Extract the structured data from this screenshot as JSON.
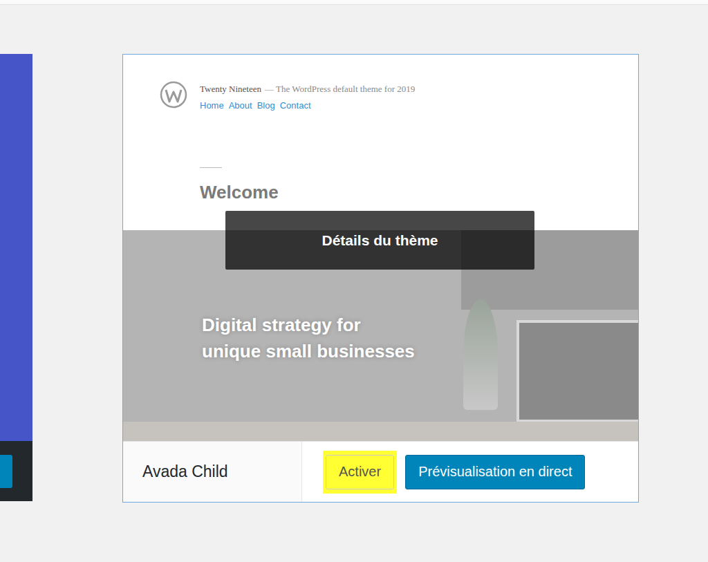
{
  "theme_card": {
    "screenshot": {
      "site_title": "Twenty Nineteen",
      "tagline": "— The WordPress default theme for 2019",
      "nav": [
        "Home",
        "About",
        "Blog",
        "Contact"
      ],
      "heading": "Welcome",
      "hero_lines": [
        "Digital strategy for",
        "unique small businesses"
      ]
    },
    "overlay": "Détails du thème",
    "name": "Avada Child",
    "buttons": [
      {
        "label": "Activer",
        "primary": false,
        "highlighted": true
      },
      {
        "label": "Prévisualisation en direct",
        "primary": true,
        "highlighted": false
      }
    ]
  }
}
